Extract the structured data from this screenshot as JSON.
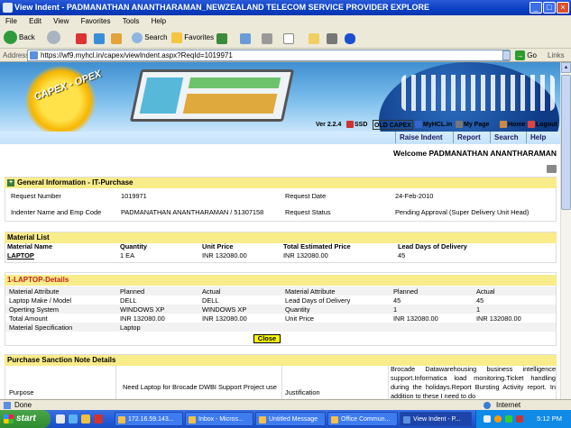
{
  "window": {
    "title": "View Indent - PADMANATHAN ANANTHARAMAN_NEWZEALAND TELECOM SERVICE PROVIDER EXPLORE",
    "buttons": {
      "minimize": "_",
      "maximize": "□",
      "close": "×"
    }
  },
  "menu": [
    "File",
    "Edit",
    "View",
    "Favorites",
    "Tools",
    "Help"
  ],
  "toolbar": {
    "back": "Back",
    "search": "Search",
    "favorites": "Favorites"
  },
  "address": {
    "label": "Address",
    "url": "https://wf9.myhcl.in/capex/viewIndent.aspx?ReqId=1019971",
    "go": "Go",
    "links": "Links"
  },
  "banner": {
    "logo": "CAPEX - OPEX"
  },
  "topnav": {
    "version": "Ver 2.2.4",
    "ssd": "SSD",
    "old_capex": "OLD CAPEX",
    "myhcl": "MyHCL.in",
    "mypage": "My Page",
    "home": "Home",
    "logout": "Logout"
  },
  "tabs": [
    "Raise Indent",
    "Report",
    "Search",
    "Help"
  ],
  "welcome": "Welcome PADMANATHAN ANANTHARAMAN",
  "general": {
    "header": "General Information - IT-Purchase",
    "request_number_label": "Request Number",
    "request_number": "1019971",
    "request_date_label": "Request Date",
    "request_date": "24-Feb-2010",
    "indenter_label": "Indenter Name and Emp Code",
    "indenter": "PADMANATHAN ANANTHARAMAN / 51307158",
    "status_label": "Request Status",
    "status": "Pending Approval (Super Delivery Unit Head)"
  },
  "material_list": {
    "header": "Material List",
    "columns": [
      "Material Name",
      "Quantity",
      "Unit Price",
      "Total Estimated Price",
      "Lead Days of Delivery"
    ],
    "rows": [
      [
        "LAPTOP",
        "1 EA",
        "INR 132080.00",
        "INR 132080.00",
        "45"
      ]
    ]
  },
  "laptop_details": {
    "header": "1-LAPTOP-Details",
    "left_columns": [
      "Material Attribute",
      "Planned",
      "Actual"
    ],
    "right_columns": [
      "Material Attribute",
      "Planned",
      "Actual"
    ],
    "rows": [
      {
        "l": [
          "Laptop Make / Model",
          "DELL",
          "DELL"
        ],
        "r": [
          "Lead Days of Delivery",
          "45",
          "45"
        ]
      },
      {
        "l": [
          "Operting System",
          "WINDOWS XP",
          "WINDOWS XP"
        ],
        "r": [
          "Quantity",
          "1",
          "1"
        ]
      },
      {
        "l": [
          "Total Amount",
          "INR 132080.00",
          "INR 132080.00"
        ],
        "r": [
          "Unit Price",
          "INR 132080.00",
          "INR 132080.00"
        ]
      }
    ],
    "spec_label": "Material Specification",
    "spec": "Laptop",
    "close": "Close"
  },
  "sanction": {
    "header": "Purchase Sanction Note Details",
    "purpose_label": "Purpose",
    "purpose": "Need Laptop for Brocade DWBI Support Project use",
    "justification_label": "Justification",
    "justification": "Brocade Datawarehousing business intelligence support.Informatica load monitoring.Ticket handling during the holidays.Report Bursting Activity report. In addition to these I need to do"
  },
  "statusbar": {
    "left": "Done",
    "zone": "Internet"
  },
  "taskbar": {
    "start": "start",
    "items": [
      "172.16.59.143...",
      "Inbox - Micros...",
      "Untitled Message",
      "Office Commun...",
      "View Indent - P..."
    ],
    "time": "5:12 PM"
  }
}
